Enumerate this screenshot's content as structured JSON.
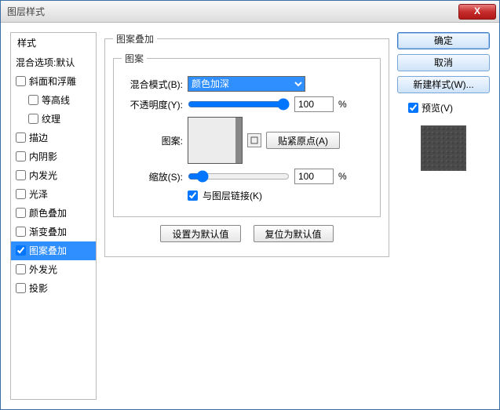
{
  "window": {
    "title": "图层样式"
  },
  "close": "X",
  "left": {
    "header": "样式",
    "blendDefault": "混合选项:默认",
    "items": [
      {
        "label": "斜面和浮雕",
        "checked": false
      },
      {
        "label": "等高线",
        "checked": false,
        "indent": true
      },
      {
        "label": "纹理",
        "checked": false,
        "indent": true
      },
      {
        "label": "描边",
        "checked": false
      },
      {
        "label": "内阴影",
        "checked": false
      },
      {
        "label": "内发光",
        "checked": false
      },
      {
        "label": "光泽",
        "checked": false
      },
      {
        "label": "颜色叠加",
        "checked": false
      },
      {
        "label": "渐变叠加",
        "checked": false
      },
      {
        "label": "图案叠加",
        "checked": true,
        "selected": true
      },
      {
        "label": "外发光",
        "checked": false
      },
      {
        "label": "投影",
        "checked": false
      }
    ]
  },
  "mid": {
    "groupTitle": "图案叠加",
    "patternGroup": "图案",
    "blendLabel": "混合模式(B):",
    "blendValue": "颜色加深",
    "opacityLabel": "不透明度(Y):",
    "opacityValue": "100",
    "percent": "%",
    "patternLabel": "图案:",
    "snapBtn": "贴紧原点(A)",
    "scaleLabel": "缩放(S):",
    "scaleValue": "100",
    "linkLabel": "与图层链接(K)",
    "setDefault": "设置为默认值",
    "resetDefault": "复位为默认值"
  },
  "right": {
    "ok": "确定",
    "cancel": "取消",
    "newStyle": "新建样式(W)...",
    "previewLabel": "预览(V)"
  }
}
